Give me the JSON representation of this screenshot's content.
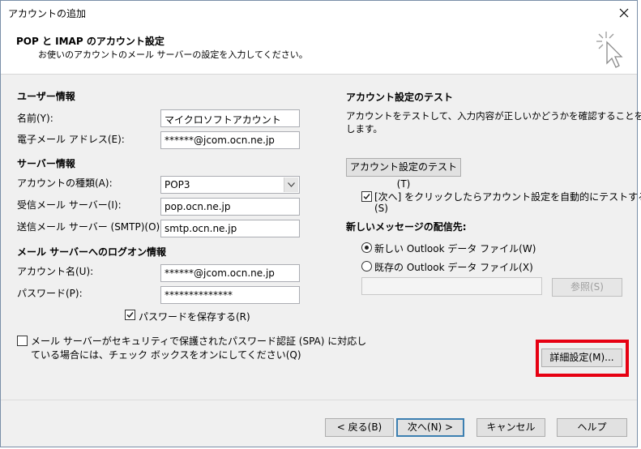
{
  "window": {
    "title": "アカウントの追加",
    "close_icon": "close-icon"
  },
  "header": {
    "title": "POP と IMAP のアカウント設定",
    "subtitle": "お使いのアカウントのメール サーバーの設定を入力してください。"
  },
  "user_info": {
    "section_title": "ユーザー情報",
    "name_label": "名前(Y):",
    "name_value": "マイクロソフトアカウント",
    "email_label": "電子メール アドレス(E):",
    "email_value": "******@jcom.ocn.ne.jp"
  },
  "server_info": {
    "section_title": "サーバー情報",
    "account_type_label": "アカウントの種類(A):",
    "account_type_value": "POP3",
    "incoming_label": "受信メール サーバー(I):",
    "incoming_value": "pop.ocn.ne.jp",
    "outgoing_label": "送信メール サーバー (SMTP)(O):",
    "outgoing_value": "smtp.ocn.ne.jp"
  },
  "logon_info": {
    "section_title": "メール サーバーへのログオン情報",
    "account_name_label": "アカウント名(U):",
    "account_name_value": "******@jcom.ocn.ne.jp",
    "password_label": "パスワード(P):",
    "password_value": "**************",
    "save_password_label": "パスワードを保存する(R)",
    "save_password_checked": true,
    "spa_line1": "メール サーバーがセキュリティで保護されたパスワード認証 (SPA) に対応し",
    "spa_line2": "ている場合には、チェック ボックスをオンにしてください(Q)",
    "spa_checked": false
  },
  "test": {
    "section_title": "アカウント設定のテスト",
    "description_line1": "アカウントをテストして、入力内容が正しいかどうかを確認することをお勧め",
    "description_line2": "します。",
    "test_button": "アカウント設定のテスト(T)",
    "auto_test_line1": "[次へ] をクリックしたらアカウント設定を自動的にテストする",
    "auto_test_line2": "(S)",
    "auto_test_checked": true
  },
  "delivery": {
    "section_title": "新しいメッセージの配信先:",
    "new_file_label": "新しい Outlook データ ファイル(W)",
    "existing_file_label": "既存の Outlook データ ファイル(X)",
    "selected": "new",
    "browse_button": "参照(S)"
  },
  "advanced_button": "詳細設定(M)...",
  "highlight_color": "#e60012",
  "footer": {
    "back": "< 戻る(B)",
    "next": "次へ(N) >",
    "cancel": "キャンセル",
    "help": "ヘルプ"
  }
}
